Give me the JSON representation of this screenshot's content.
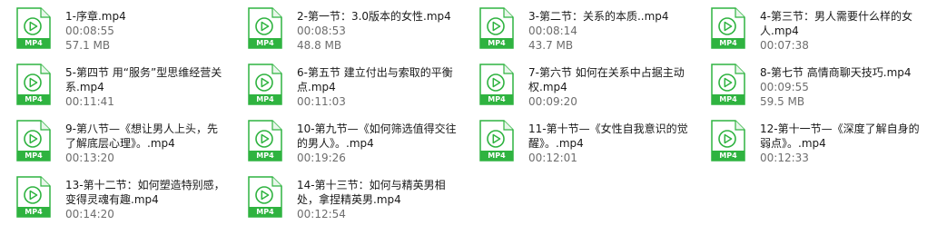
{
  "file_type_badge": "MP4",
  "icon_color": "#2fb340",
  "files": [
    {
      "name": "1-序章.mp4",
      "duration": "00:08:55",
      "size": "57.1 MB"
    },
    {
      "name": "2-第一节：3.0版本的女性.mp4",
      "duration": "00:08:53",
      "size": "48.8 MB"
    },
    {
      "name": "3-第二节：关系的本质..mp4",
      "duration": "00:08:14",
      "size": "43.7 MB"
    },
    {
      "name": "4-第三节：男人需要什么样的女人.mp4",
      "duration": "00:07:38",
      "size": ""
    },
    {
      "name": "5-第四节 用“服务”型思维经营关系.mp4",
      "duration": "00:11:41",
      "size": ""
    },
    {
      "name": "6-第五节 建立付出与索取的平衡点.mp4",
      "duration": "00:11:03",
      "size": ""
    },
    {
      "name": "7-第六节 如何在关系中占据主动权.mp4",
      "duration": "00:09:20",
      "size": ""
    },
    {
      "name": "8-第七节 高情商聊天技巧.mp4",
      "duration": "00:09:55",
      "size": "59.5 MB"
    },
    {
      "name": "9-第八节—《想让男人上头，先了解底层心理》。.mp4",
      "duration": "00:13:20",
      "size": ""
    },
    {
      "name": "10-第九节—《如何筛选值得交往的男人》。.mp4",
      "duration": "00:19:26",
      "size": ""
    },
    {
      "name": "11-第十节—《女性自我意识的觉醒》。.mp4",
      "duration": "00:12:01",
      "size": ""
    },
    {
      "name": "12-第十一节—《深度了解自身的弱点》。.mp4",
      "duration": "00:12:33",
      "size": ""
    },
    {
      "name": "13-第十二节：如何塑造特别感，变得灵魂有趣.mp4",
      "duration": "00:14:20",
      "size": ""
    },
    {
      "name": "14-第十三节：如何与精英男相处，拿捏精英男.mp4",
      "duration": "00:12:54",
      "size": ""
    }
  ]
}
